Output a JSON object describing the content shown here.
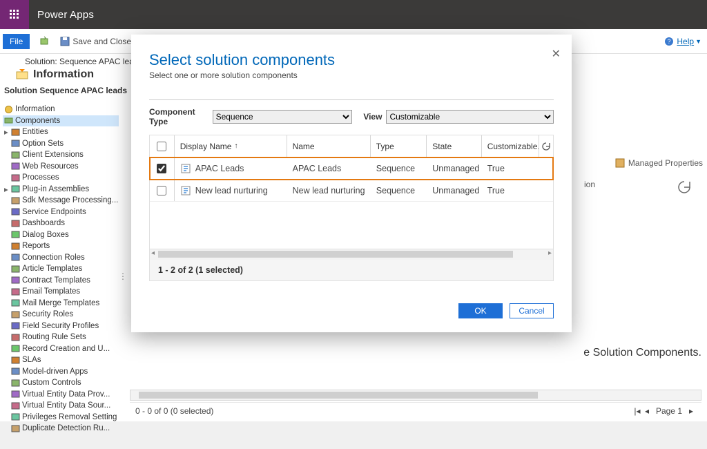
{
  "app": {
    "title": "Power Apps"
  },
  "ribbon": {
    "file": "File",
    "save_close": "Save and Close",
    "help": "Help"
  },
  "breadcrumb": {
    "line1": "Solution: Sequence APAC leads",
    "title": "Information",
    "section": "Solution Sequence APAC leads"
  },
  "sidebar": {
    "top": "Information",
    "components_label": "Components",
    "items": [
      "Entities",
      "Option Sets",
      "Client Extensions",
      "Web Resources",
      "Processes",
      "Plug-in Assemblies",
      "Sdk Message Processing...",
      "Service Endpoints",
      "Dashboards",
      "Dialog Boxes",
      "Reports",
      "Connection Roles",
      "Article Templates",
      "Contract Templates",
      "Email Templates",
      "Mail Merge Templates",
      "Security Roles",
      "Field Security Profiles",
      "Routing Rule Sets",
      "Record Creation and U...",
      "SLAs",
      "Model-driven Apps",
      "Custom Controls",
      "Virtual Entity Data Prov...",
      "Virtual Entity Data Sour...",
      "Privileges Removal Setting",
      "Duplicate Detection Ru..."
    ]
  },
  "behind": {
    "managed_props": "Managed Properties",
    "tag_suffix": "ion",
    "hint_suffix": "e Solution Components.",
    "status": "0 - 0 of 0 (0 selected)",
    "page_label": "Page 1"
  },
  "dialog": {
    "title": "Select solution components",
    "subtitle": "Select one or more solution components",
    "ct_label": "Component Type",
    "ct_value": "Sequence",
    "view_label": "View",
    "view_value": "Customizable",
    "columns": {
      "display_name": "Display Name",
      "name": "Name",
      "type": "Type",
      "state": "State",
      "customizable": "Customizable..."
    },
    "rows": [
      {
        "dn": "APAC Leads",
        "nm": "APAC Leads",
        "ty": "Sequence",
        "st": "Unmanaged",
        "cu": "True",
        "checked": true
      },
      {
        "dn": "New lead nurturing",
        "nm": "New lead nurturing",
        "ty": "Sequence",
        "st": "Unmanaged",
        "cu": "True",
        "checked": false
      }
    ],
    "footer": "1 - 2 of 2 (1 selected)",
    "ok": "OK",
    "cancel": "Cancel"
  }
}
